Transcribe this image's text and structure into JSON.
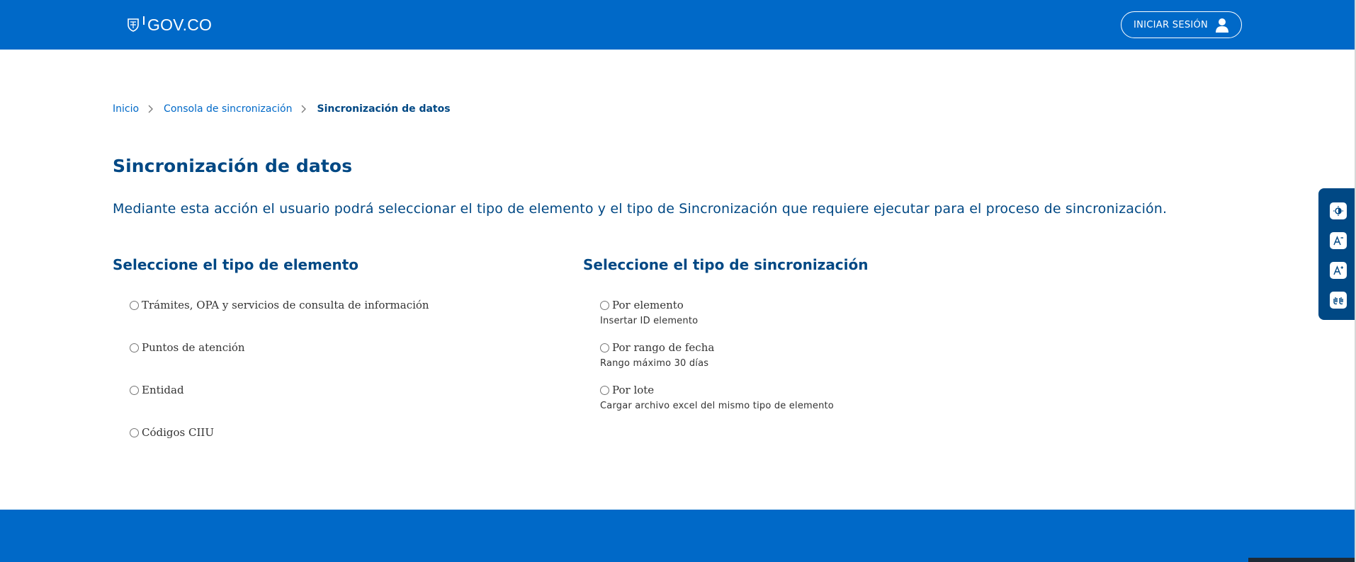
{
  "header": {
    "logo_text": "GOV.CO",
    "login_label": "INICIAR SESIÓN"
  },
  "breadcrumb": {
    "items": [
      "Inicio",
      "Consola de sincronización"
    ],
    "current": "Sincronización de datos"
  },
  "page": {
    "title": "Sincronización de datos",
    "description": "Mediante esta acción el usuario podrá seleccionar el tipo de elemento y el tipo de Sincronización que requiere ejecutar para el proceso de sincronización."
  },
  "element_type": {
    "title": "Seleccione el tipo de elemento",
    "options": [
      "Trámites, OPA y servicios de consulta de información",
      "Puntos de atención",
      "Entidad",
      "Códigos CIIU"
    ]
  },
  "sync_type": {
    "title": "Seleccione el tipo de sincronización",
    "options": [
      {
        "label": "Por elemento",
        "hint": "Insertar ID elemento"
      },
      {
        "label": "Por rango de fecha",
        "hint": "Rango máximo 30 días"
      },
      {
        "label": "Por lote",
        "hint": "Cargar archivo excel del mismo tipo de elemento"
      }
    ]
  },
  "accessibility": {
    "buttons": [
      "contrast-icon",
      "font-decrease-icon",
      "font-increase-icon",
      "sign-language-icon"
    ]
  },
  "colors": {
    "brand_blue": "#0069c8",
    "dark_blue": "#004884",
    "white": "#ffffff"
  }
}
